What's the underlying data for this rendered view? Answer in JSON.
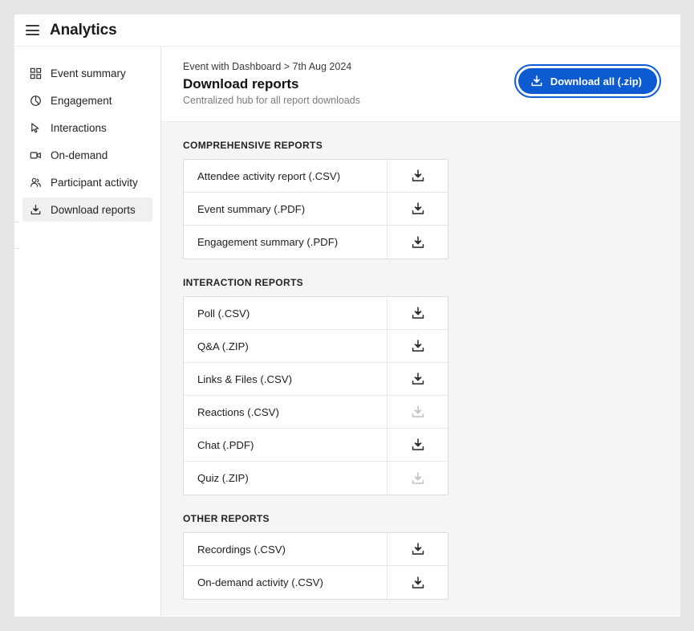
{
  "window": {
    "app_title": "Analytics",
    "menu_icon": "hamburger-icon",
    "accent_color": "#0d5bd1",
    "page_background": "#f5f5f5",
    "card_background": "#ffffff"
  },
  "sidebar": {
    "items": [
      {
        "label": "Event summary",
        "icon": "grid-icon",
        "selected": false
      },
      {
        "label": "Engagement",
        "icon": "pie-chart-icon",
        "selected": false
      },
      {
        "label": "Interactions",
        "icon": "cursor-arrow-icon",
        "selected": false
      },
      {
        "label": "On-demand",
        "icon": "video-camera-icon",
        "selected": false
      },
      {
        "label": "Participant activity",
        "icon": "people-icon",
        "selected": false
      },
      {
        "label": "Download reports",
        "icon": "download-icon",
        "selected": true
      }
    ]
  },
  "header": {
    "breadcrumb": "Event with Dashboard > 7th Aug 2024",
    "title": "Download reports",
    "subtitle": "Centralized hub for all report downloads",
    "download_all": {
      "label": "Download all (.zip)",
      "icon": "download-icon",
      "focused": true
    }
  },
  "sections": [
    {
      "heading": "COMPREHENSIVE REPORTS",
      "rows": [
        {
          "label": "Attendee activity report (.CSV)",
          "download_enabled": true
        },
        {
          "label": "Event summary (.PDF)",
          "download_enabled": true
        },
        {
          "label": "Engagement summary (.PDF)",
          "download_enabled": true
        }
      ]
    },
    {
      "heading": "INTERACTION REPORTS",
      "rows": [
        {
          "label": "Poll (.CSV)",
          "download_enabled": true
        },
        {
          "label": "Q&A (.ZIP)",
          "download_enabled": true
        },
        {
          "label": "Links & Files (.CSV)",
          "download_enabled": true
        },
        {
          "label": "Reactions (.CSV)",
          "download_enabled": false
        },
        {
          "label": "Chat (.PDF)",
          "download_enabled": true
        },
        {
          "label": "Quiz (.ZIP)",
          "download_enabled": false
        }
      ]
    },
    {
      "heading": "OTHER REPORTS",
      "rows": [
        {
          "label": "Recordings (.CSV)",
          "download_enabled": true
        },
        {
          "label": "On-demand activity (.CSV)",
          "download_enabled": true
        }
      ]
    }
  ]
}
